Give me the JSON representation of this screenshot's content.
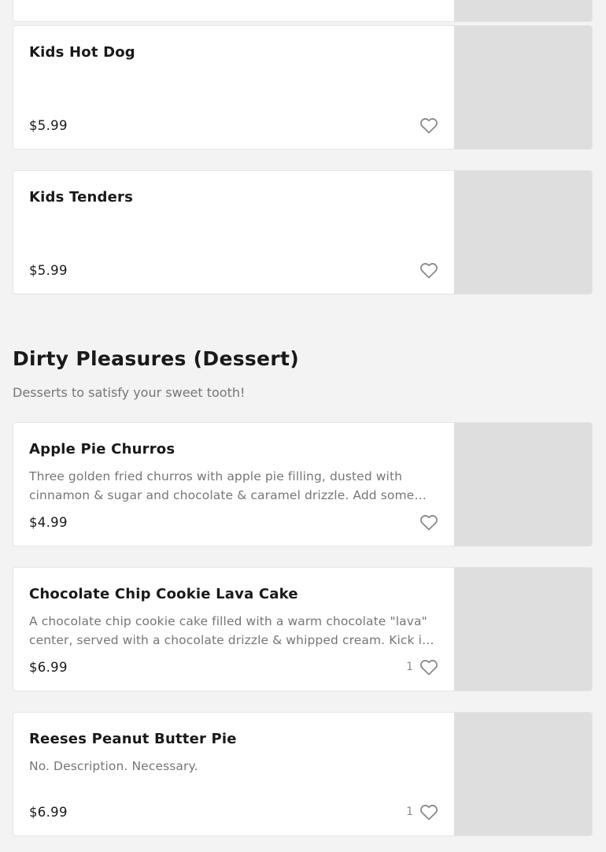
{
  "menu": {
    "previous_items": [
      {
        "title": "Kids Hot Dog",
        "description": "",
        "price": "$5.99",
        "favorites": ""
      },
      {
        "title": "Kids Tenders",
        "description": "",
        "price": "$5.99",
        "favorites": ""
      }
    ],
    "section": {
      "title": "Dirty Pleasures (Dessert)",
      "subtitle": "Desserts to satisfy your sweet tooth!"
    },
    "items": [
      {
        "title": "Apple Pie Churros",
        "description": "Three golden fried churros with apple pie filling, dusted with cinnamon & sugar and chocolate & caramel drizzle. Add some Ice...",
        "price": "$4.99",
        "favorites": ""
      },
      {
        "title": "Chocolate Chip Cookie Lava Cake",
        "description": "A chocolate chip cookie cake filled with a warm chocolate \"lava\" center, served with a chocolate drizzle & whipped cream. Kick it up ...",
        "price": "$6.99",
        "favorites": "1"
      },
      {
        "title": "Reeses Peanut Butter Pie",
        "description": "No. Description. Necessary.",
        "price": "$6.99",
        "favorites": "1"
      }
    ]
  },
  "icons": {
    "favorite": "heart-outline-icon"
  },
  "colors": {
    "background": "#f3f3f3",
    "card": "#ffffff",
    "image_placeholder": "#dedede",
    "text_primary": "#191919",
    "text_secondary": "#767676",
    "icon": "#8a8a8a"
  }
}
